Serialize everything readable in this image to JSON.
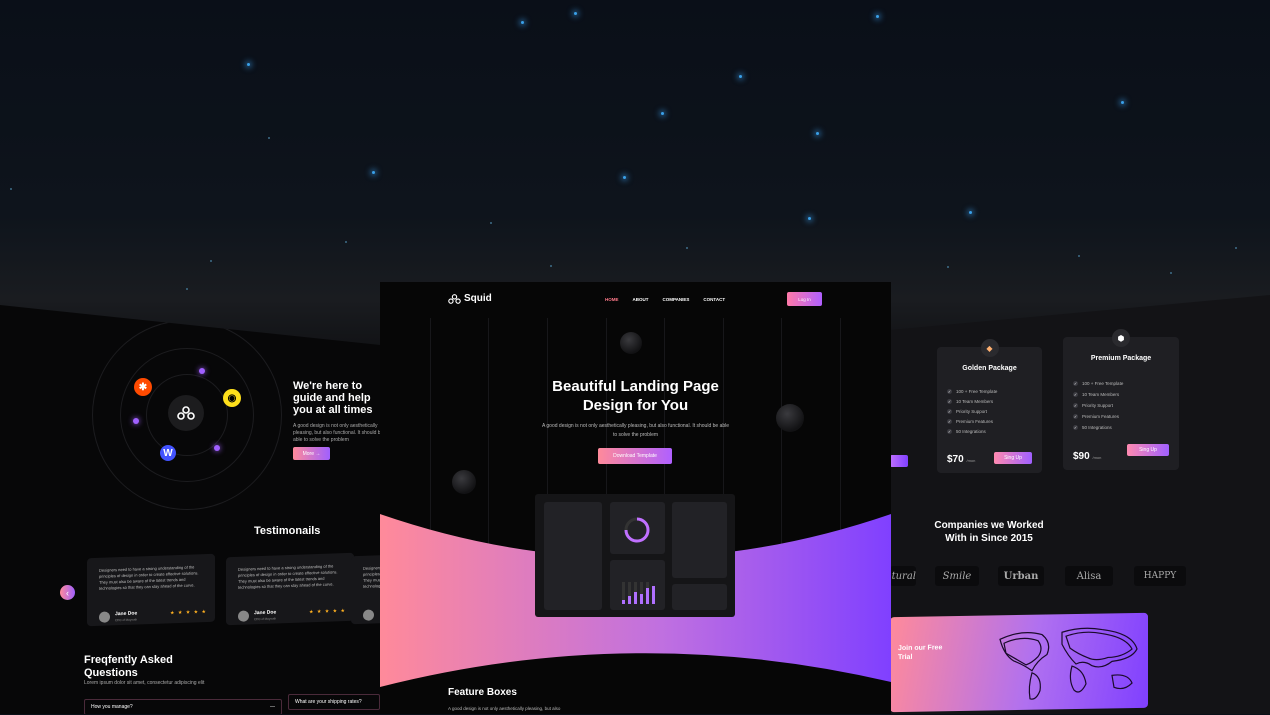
{
  "left": {
    "guide_title": "We're here to guide and help you at all times",
    "guide_text": "A good design is not only aesthetically pleasing, but also functional. It should be able to solve the problem",
    "more_label": "More →",
    "testimonials_title": "Testimonails",
    "testimonial_text": "Designers need to have a strong understanding of the principles of design in order to create effective solutions. They must also be aware of the latest trends and technologies so that they can stay ahead of the curve.",
    "testimonial_name": "Jane Doe",
    "testimonial_role": "CEO of Mayooth",
    "stars": "★ ★ ★ ★ ★",
    "prev_icon": "‹",
    "faq_title": "Freqfently Asked Questions",
    "faq_subtitle": "Lorem ipsum dolor sit amet, consectetur adipiscing elit",
    "faq_q1": "How you manage?",
    "faq_q1_toggle": "—",
    "faq_q2": "What are your shipping rates?"
  },
  "center": {
    "brand": "Squid",
    "nav": [
      "HOME",
      "ABOUT",
      "COMPANIES",
      "CONTACT"
    ],
    "login": "Log In",
    "hero_title_1": "Beautiful Landing Page",
    "hero_title_2": "Design for You",
    "hero_text": "A good design is not only aesthetically pleasing, but also functional. It should be able to solve the problem",
    "download": "Download Template",
    "feature_title": "Feature Boxes",
    "feature_text": "A good design is not only aesthetically pleasing, but also"
  },
  "right": {
    "golden": {
      "title": "Golden Package",
      "features": [
        "100 + Free Template",
        "10 Team Members",
        "Priority Support",
        "Premium Features",
        "50 Integrations"
      ],
      "price": "$70",
      "unit": "/mon",
      "signup": "Sing Up"
    },
    "premium": {
      "title": "Premium Package",
      "features": [
        "100 + Free Template",
        "10 Team Members",
        "Priority Support",
        "Premium Features",
        "50 Integrations"
      ],
      "price": "$90",
      "unit": "/mon",
      "signup": "Sing Up"
    },
    "companies_title": "Companies we Worked With in Since 2015",
    "logos": [
      "Natural",
      "Smile",
      "Urban",
      "Alisa",
      "HAPPY"
    ],
    "trial_text": "Join our Free Trial"
  },
  "colors": {
    "accent_pink": "#ff8a9a",
    "accent_purple": "#8040ff",
    "active_nav": "#ff7a8a"
  }
}
